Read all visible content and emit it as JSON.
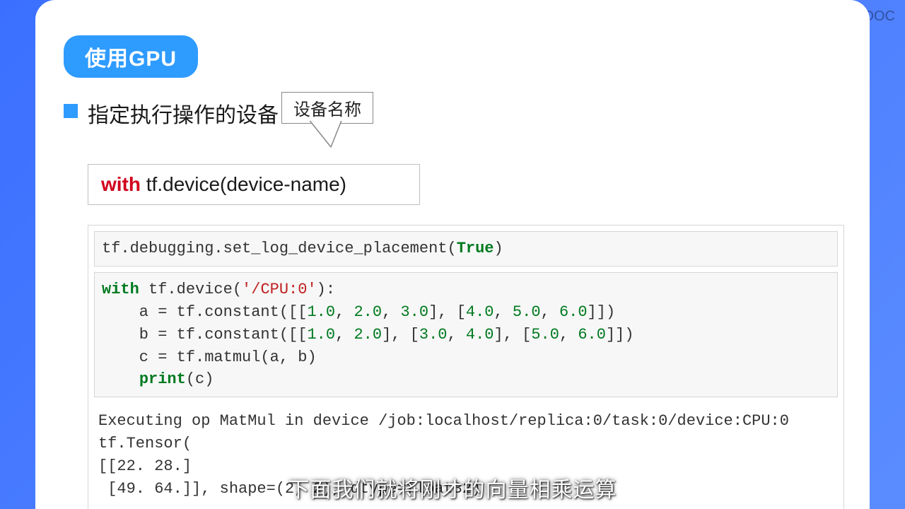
{
  "watermark": {
    "text": "中国大学MOOC"
  },
  "badge": {
    "label": "使用GPU"
  },
  "heading": {
    "text": "指定执行操作的设备"
  },
  "callout": {
    "label": "设备名称"
  },
  "api": {
    "with": "with",
    "rest": " tf.device(device-name)"
  },
  "code": {
    "cell1": {
      "prefix": "tf.debugging.set_log_device_placement(",
      "arg": "True",
      "suffix": ")"
    },
    "cell2": {
      "l1_kw": "with",
      "l1_rest": " tf.device(",
      "l1_str": "'/CPU:0'",
      "l1_end": "):",
      "l2_pre": "    a = tf.constant([[",
      "l2_n1": "1.0",
      "l2_c1": ", ",
      "l2_n2": "2.0",
      "l2_c2": ", ",
      "l2_n3": "3.0",
      "l2_mid": "], [",
      "l2_n4": "4.0",
      "l2_c3": ", ",
      "l2_n5": "5.0",
      "l2_c4": ", ",
      "l2_n6": "6.0",
      "l2_end": "]])",
      "l3_pre": "    b = tf.constant([[",
      "l3_n1": "1.0",
      "l3_c1": ", ",
      "l3_n2": "2.0",
      "l3_mid1": "], [",
      "l3_n3": "3.0",
      "l3_c2": ", ",
      "l3_n4": "4.0",
      "l3_mid2": "], [",
      "l3_n5": "5.0",
      "l3_c3": ", ",
      "l3_n6": "6.0",
      "l3_end": "]])",
      "l4": "    c = tf.matmul(a, b)",
      "l5_pre": "    ",
      "l5_fn": "print",
      "l5_end": "(c)"
    },
    "output": "Executing op MatMul in device /job:localhost/replica:0/task:0/device:CPU:0\ntf.Tensor(\n[[22. 28.]\n [49. 64.]], shape=(2, 2), dtype=float32)"
  },
  "subtitle": {
    "text": "下面我们就将刚才的向量相乘运算"
  }
}
